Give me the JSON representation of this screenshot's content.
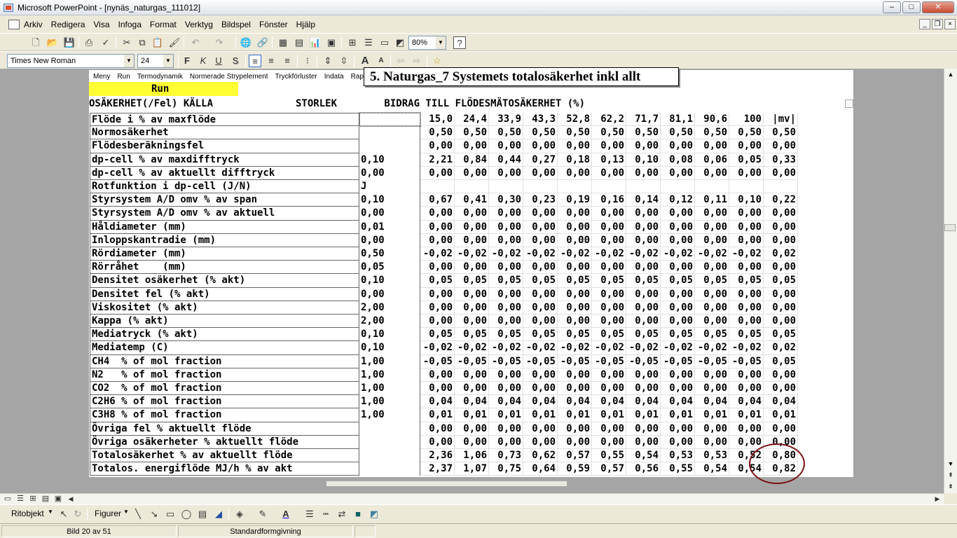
{
  "window": {
    "title": "Microsoft PowerPoint - [nynäs_naturgas_111012]",
    "min": "–",
    "max": "□",
    "close": "✕"
  },
  "menu": [
    "Arkiv",
    "Redigera",
    "Visa",
    "Infoga",
    "Format",
    "Verktyg",
    "Bildspel",
    "Fönster",
    "Hjälp"
  ],
  "toolbar": {
    "zoom": "80%",
    "font": "Times New Roman",
    "size": "24",
    "bold": "F",
    "italic": "K",
    "underline": "U",
    "shadow": "S"
  },
  "slide": {
    "nav": [
      "Meny",
      "Run",
      "Termodynamik",
      "Normerade Strypelement",
      "Tryckförluster",
      "Indata",
      "Rapp"
    ],
    "title": "5. Naturgas_7 Systemets totalosäkerhet inkl allt",
    "run": "Run",
    "header": "OSÄKERHET(/Fel) KÄLLA              STORLEK        BIDRAG TILL FLÖDESMÄTOSÄKERHET (%)",
    "columns": [
      "15,0",
      "24,4",
      "33,9",
      "43,3",
      "52,8",
      "62,2",
      "71,7",
      "81,1",
      "90,6",
      "100",
      "|mv|"
    ],
    "rows": [
      {
        "label": "Flöde i % av maxflöde",
        "size": "",
        "vals": []
      },
      {
        "label": "Normosäkerhet",
        "size": "",
        "vals": [
          "0,50",
          "0,50",
          "0,50",
          "0,50",
          "0,50",
          "0,50",
          "0,50",
          "0,50",
          "0,50",
          "0,50",
          "0,50"
        ]
      },
      {
        "label": "Flödesberäkningsfel",
        "size": "",
        "vals": [
          "0,00",
          "0,00",
          "0,00",
          "0,00",
          "0,00",
          "0,00",
          "0,00",
          "0,00",
          "0,00",
          "0,00",
          "0,00"
        ]
      },
      {
        "label": "dp-cell % av maxdifftryck",
        "size": "0,10",
        "vals": [
          "2,21",
          "0,84",
          "0,44",
          "0,27",
          "0,18",
          "0,13",
          "0,10",
          "0,08",
          "0,06",
          "0,05",
          "0,33"
        ]
      },
      {
        "label": "dp-cell % av aktuellt difftryck",
        "size": "0,00",
        "vals": [
          "0,00",
          "0,00",
          "0,00",
          "0,00",
          "0,00",
          "0,00",
          "0,00",
          "0,00",
          "0,00",
          "0,00",
          "0,00"
        ]
      },
      {
        "label": "Rotfunktion i dp-cell (J/N)",
        "size": "J",
        "vals": [
          "",
          "",
          "",
          "",
          "",
          "",
          "",
          "",
          "",
          "",
          ""
        ]
      },
      {
        "label": "Styrsystem A/D omv % av span",
        "size": "0,10",
        "vals": [
          "0,67",
          "0,41",
          "0,30",
          "0,23",
          "0,19",
          "0,16",
          "0,14",
          "0,12",
          "0,11",
          "0,10",
          "0,22"
        ]
      },
      {
        "label": "Styrsystem A/D omv % av aktuell",
        "size": "0,00",
        "vals": [
          "0,00",
          "0,00",
          "0,00",
          "0,00",
          "0,00",
          "0,00",
          "0,00",
          "0,00",
          "0,00",
          "0,00",
          "0,00"
        ]
      },
      {
        "label": "Håldiameter (mm)",
        "size": "0,01",
        "vals": [
          "0,00",
          "0,00",
          "0,00",
          "0,00",
          "0,00",
          "0,00",
          "0,00",
          "0,00",
          "0,00",
          "0,00",
          "0,00"
        ]
      },
      {
        "label": "Inloppskantradie (mm)",
        "size": "0,00",
        "vals": [
          "0,00",
          "0,00",
          "0,00",
          "0,00",
          "0,00",
          "0,00",
          "0,00",
          "0,00",
          "0,00",
          "0,00",
          "0,00"
        ]
      },
      {
        "label": "Rördiameter (mm)",
        "size": "0,50",
        "vals": [
          "-0,02",
          "-0,02",
          "-0,02",
          "-0,02",
          "-0,02",
          "-0,02",
          "-0,02",
          "-0,02",
          "-0,02",
          "-0,02",
          "0,02"
        ]
      },
      {
        "label": "Rörråhet    (mm)",
        "size": "0,05",
        "vals": [
          "0,00",
          "0,00",
          "0,00",
          "0,00",
          "0,00",
          "0,00",
          "0,00",
          "0,00",
          "0,00",
          "0,00",
          "0,00"
        ]
      },
      {
        "label": "Densitet osäkerhet (% akt)",
        "size": "0,10",
        "vals": [
          "0,05",
          "0,05",
          "0,05",
          "0,05",
          "0,05",
          "0,05",
          "0,05",
          "0,05",
          "0,05",
          "0,05",
          "0,05"
        ]
      },
      {
        "label": "Densitet fel (% akt)",
        "size": "0,00",
        "vals": [
          "0,00",
          "0,00",
          "0,00",
          "0,00",
          "0,00",
          "0,00",
          "0,00",
          "0,00",
          "0,00",
          "0,00",
          "0,00"
        ]
      },
      {
        "label": "Viskositet (% akt)",
        "size": "2,00",
        "vals": [
          "0,00",
          "0,00",
          "0,00",
          "0,00",
          "0,00",
          "0,00",
          "0,00",
          "0,00",
          "0,00",
          "0,00",
          "0,00"
        ]
      },
      {
        "label": "Kappa (% akt)",
        "size": "2,00",
        "vals": [
          "0,00",
          "0,00",
          "0,00",
          "0,00",
          "0,00",
          "0,00",
          "0,00",
          "0,00",
          "0,00",
          "0,00",
          "0,00"
        ]
      },
      {
        "label": "Mediatryck (% akt)",
        "size": "0,10",
        "vals": [
          "0,05",
          "0,05",
          "0,05",
          "0,05",
          "0,05",
          "0,05",
          "0,05",
          "0,05",
          "0,05",
          "0,05",
          "0,05"
        ]
      },
      {
        "label": "Mediatemp (C)",
        "size": "0,10",
        "vals": [
          "-0,02",
          "-0,02",
          "-0,02",
          "-0,02",
          "-0,02",
          "-0,02",
          "-0,02",
          "-0,02",
          "-0,02",
          "-0,02",
          "0,02"
        ]
      },
      {
        "label": "CH4  % of mol fraction",
        "size": "1,00",
        "vals": [
          "-0,05",
          "-0,05",
          "-0,05",
          "-0,05",
          "-0,05",
          "-0,05",
          "-0,05",
          "-0,05",
          "-0,05",
          "-0,05",
          "0,05"
        ]
      },
      {
        "label": "N2   % of mol fraction",
        "size": "1,00",
        "vals": [
          "0,00",
          "0,00",
          "0,00",
          "0,00",
          "0,00",
          "0,00",
          "0,00",
          "0,00",
          "0,00",
          "0,00",
          "0,00"
        ]
      },
      {
        "label": "CO2  % of mol fraction",
        "size": "1,00",
        "vals": [
          "0,00",
          "0,00",
          "0,00",
          "0,00",
          "0,00",
          "0,00",
          "0,00",
          "0,00",
          "0,00",
          "0,00",
          "0,00"
        ]
      },
      {
        "label": "C2H6 % of mol fraction",
        "size": "1,00",
        "vals": [
          "0,04",
          "0,04",
          "0,04",
          "0,04",
          "0,04",
          "0,04",
          "0,04",
          "0,04",
          "0,04",
          "0,04",
          "0,04"
        ]
      },
      {
        "label": "C3H8 % of mol fraction",
        "size": "1,00",
        "vals": [
          "0,01",
          "0,01",
          "0,01",
          "0,01",
          "0,01",
          "0,01",
          "0,01",
          "0,01",
          "0,01",
          "0,01",
          "0,01"
        ]
      },
      {
        "label": "Övriga fel % aktuellt flöde",
        "size": "",
        "vals": [
          "0,00",
          "0,00",
          "0,00",
          "0,00",
          "0,00",
          "0,00",
          "0,00",
          "0,00",
          "0,00",
          "0,00",
          "0,00"
        ]
      },
      {
        "label": "Övriga osäkerheter % aktuellt flöde",
        "size": "",
        "vals": [
          "0,00",
          "0,00",
          "0,00",
          "0,00",
          "0,00",
          "0,00",
          "0,00",
          "0,00",
          "0,00",
          "0,00",
          "0,00"
        ]
      },
      {
        "label": "Totalosäkerhet % av aktuellt flöde",
        "size": "",
        "vals": [
          "2,36",
          "1,06",
          "0,73",
          "0,62",
          "0,57",
          "0,55",
          "0,54",
          "0,53",
          "0,53",
          "0,52",
          "0,80"
        ]
      },
      {
        "label": "Totalos. energiflöde MJ/h % av akt",
        "size": "",
        "vals": [
          "2,37",
          "1,07",
          "0,75",
          "0,64",
          "0,59",
          "0,57",
          "0,56",
          "0,55",
          "0,54",
          "0,54",
          "0,82"
        ]
      }
    ]
  },
  "drawbar": {
    "draw": "Ritobjekt",
    "shapes": "Figurer"
  },
  "status": {
    "slide": "Bild 20 av 51",
    "design": "Standardformgivning"
  }
}
